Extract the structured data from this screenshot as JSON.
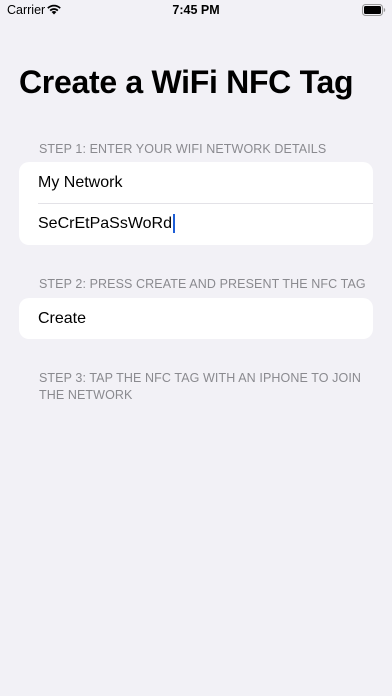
{
  "status_bar": {
    "carrier": "Carrier",
    "time": "7:45 PM"
  },
  "title": "Create a WiFi NFC Tag",
  "step1": {
    "header": "STEP 1: ENTER YOUR WIFI NETWORK DETAILS",
    "network_name": "My Network",
    "password": "SeCrEtPaSsWoRd"
  },
  "step2": {
    "header": "STEP 2: PRESS CREATE AND PRESENT THE NFC TAG",
    "create_label": "Create"
  },
  "step3": {
    "header": "STEP 3: TAP THE NFC TAG WITH AN IPHONE TO JOIN THE NETWORK"
  },
  "colors": {
    "background": "#F2F1F6",
    "card": "#FFFFFF",
    "section_header": "#8A8A8F",
    "caret": "#1F5FD6"
  }
}
